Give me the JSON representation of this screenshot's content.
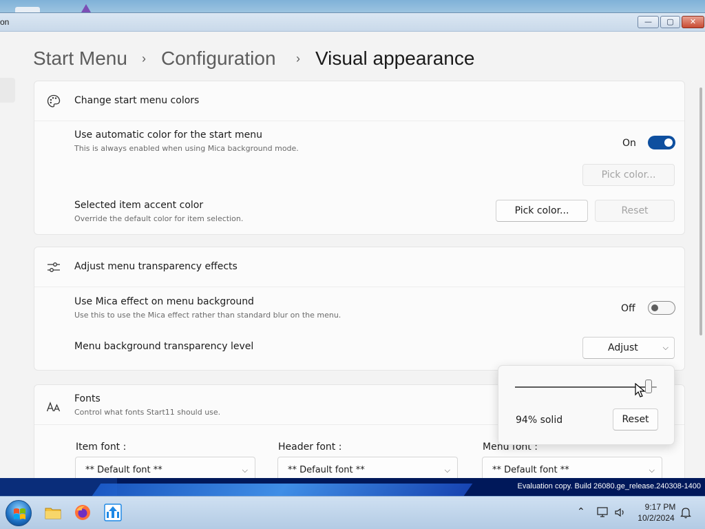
{
  "window": {
    "title_fragment": "on",
    "controls": {
      "minimize": "—",
      "maximize": "▢",
      "close": "✕"
    }
  },
  "breadcrumb": {
    "items": [
      "Start Menu",
      "Configuration",
      "Visual appearance"
    ],
    "separator": "›"
  },
  "sections": {
    "colors": {
      "title": "Change start menu colors",
      "icon": "palette-icon",
      "auto_color": {
        "title": "Use automatic color for the start menu",
        "desc": "This is always enabled when using Mica background mode.",
        "state_label": "On",
        "state": true,
        "pick_label": "Pick color..."
      },
      "accent": {
        "title": "Selected item accent color",
        "desc": "Override the default color for item selection.",
        "pick_label": "Pick color...",
        "reset_label": "Reset"
      }
    },
    "transparency": {
      "title": "Adjust menu transparency effects",
      "icon": "sliders-icon",
      "mica": {
        "title": "Use Mica effect on menu background",
        "desc": "Use this to use the Mica effect rather than standard blur on the menu.",
        "state_label": "Off",
        "state": false
      },
      "level": {
        "title": "Menu background transparency level",
        "button_label": "Adjust"
      }
    },
    "fonts": {
      "title": "Fonts",
      "desc": "Control what fonts Start11 should use.",
      "icon": "font-size-icon",
      "item_font": {
        "label": "Item font :",
        "value": "** Default font **"
      },
      "header_font": {
        "label": "Header font :",
        "value": "** Default font **"
      },
      "menu_font": {
        "label": "Menu font :",
        "value": "** Default font **"
      }
    }
  },
  "flyout": {
    "slider_value": 0.94,
    "value_text": "94% solid",
    "reset_label": "Reset"
  },
  "desktop": {
    "watermark": "Evaluation copy. Build 26080.ge_release.240308-1400"
  },
  "taskbar": {
    "icons": [
      "windows-start-icon",
      "file-explorer-icon",
      "firefox-icon",
      "start11-icon"
    ],
    "time": "9:17 PM",
    "date": "10/2/2024"
  },
  "colors": {
    "accent": "#0e4f9f",
    "card_bg": "#fbfbfb",
    "window_bg": "#f3f3f3"
  }
}
